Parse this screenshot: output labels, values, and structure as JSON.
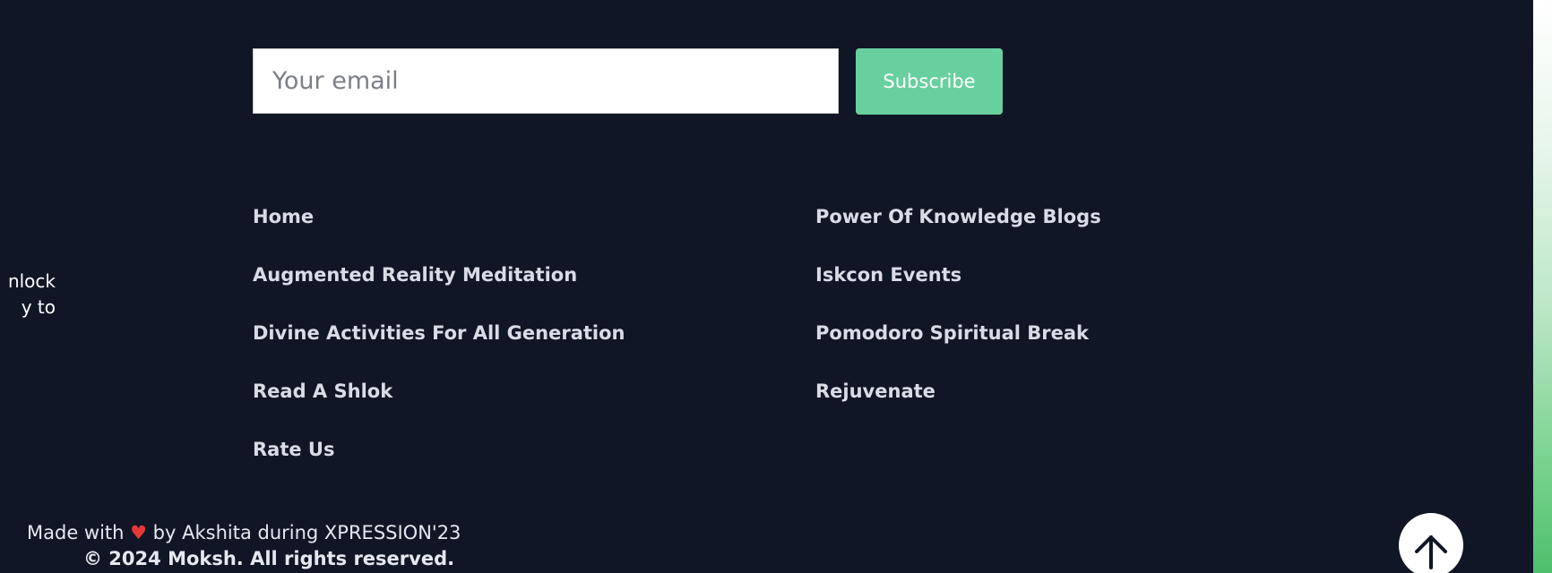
{
  "newsletter": {
    "email_placeholder": "Your email",
    "subscribe_label": "Subscribe"
  },
  "footer_nav": {
    "column1": [
      {
        "label": "Home"
      },
      {
        "label": "Augmented Reality Meditation"
      },
      {
        "label": "Divine Activities For All Generation"
      },
      {
        "label": "Read A Shlok"
      },
      {
        "label": "Rate Us"
      }
    ],
    "column2": [
      {
        "label": "Power Of Knowledge Blogs"
      },
      {
        "label": "Iskcon Events"
      },
      {
        "label": "Pomodoro Spiritual Break"
      },
      {
        "label": "Rejuvenate"
      }
    ]
  },
  "left_text": {
    "line1": "nlock",
    "line2": "y to"
  },
  "credits": {
    "made_with_prefix": "Made with",
    "heart": "♥",
    "made_with_suffix": "by Akshita during XPRESSION'23",
    "copyright": "© 2024 Moksh. All rights reserved."
  },
  "icons": {
    "scroll_top": "arrow-up-icon"
  },
  "colors": {
    "background": "#111627",
    "accent": "#68d09e",
    "nav_text": "#d9dce6"
  }
}
